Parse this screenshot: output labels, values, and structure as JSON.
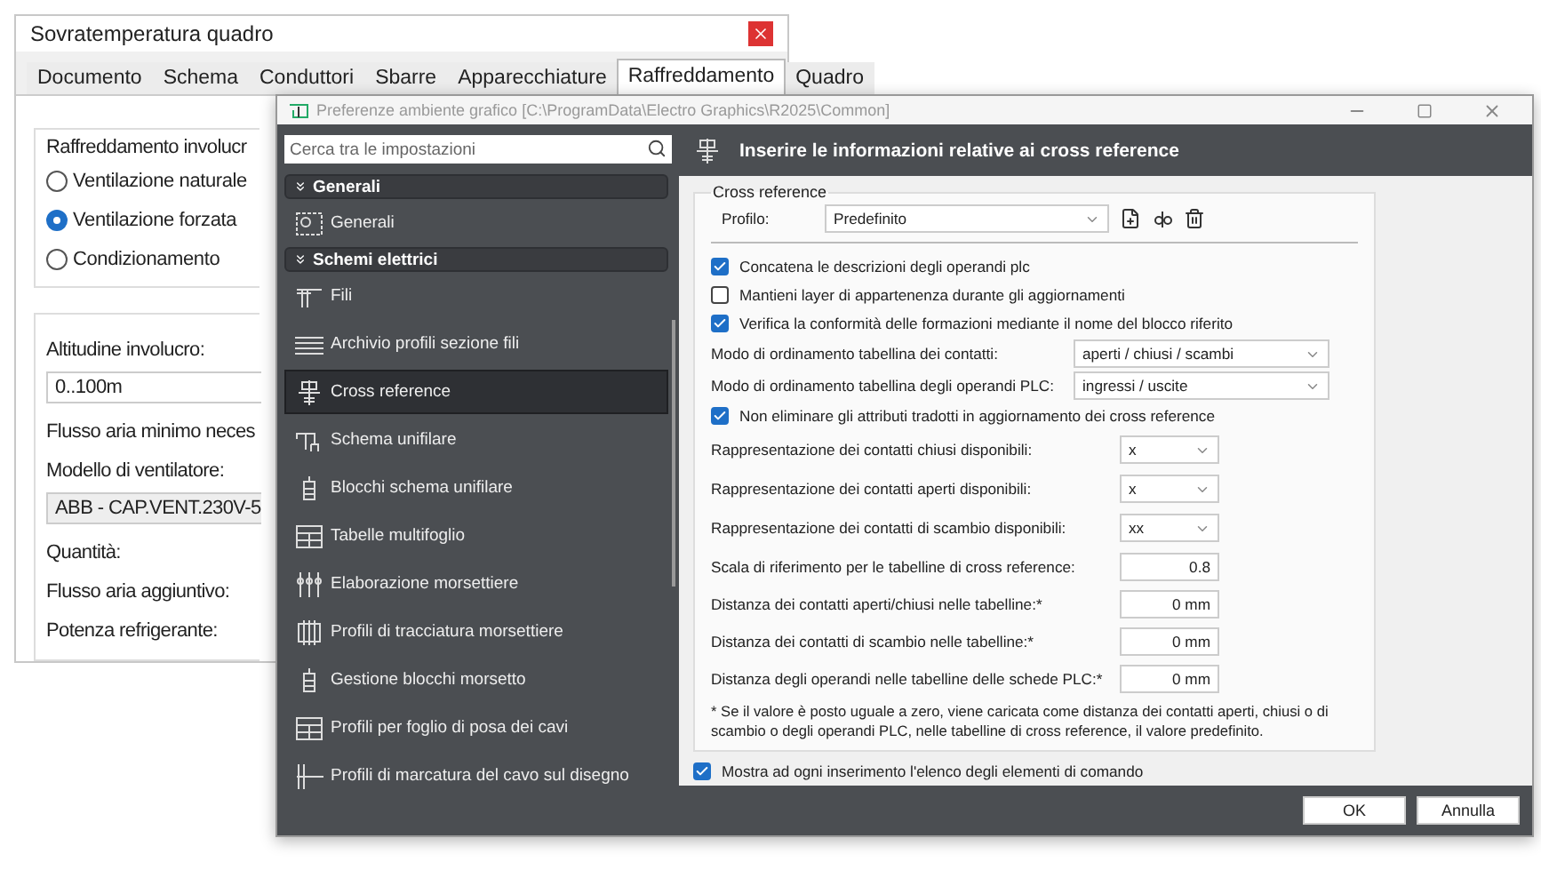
{
  "back_window": {
    "title": "Sovratemperatura quadro",
    "tabs": [
      {
        "label": "Documento",
        "selected": false
      },
      {
        "label": "Schema",
        "selected": false
      },
      {
        "label": "Conduttori",
        "selected": false
      },
      {
        "label": "Sbarre",
        "selected": false
      },
      {
        "label": "Apparecchiature",
        "selected": false
      },
      {
        "label": "Raffreddamento",
        "selected": true
      },
      {
        "label": "Quadro",
        "selected": false
      }
    ],
    "cooling_group": {
      "title": "Raffreddamento involucr",
      "options": [
        {
          "label": "Ventilazione naturale",
          "selected": false
        },
        {
          "label": "Ventilazione forzata",
          "selected": true
        },
        {
          "label": "Condizionamento",
          "selected": false
        }
      ]
    },
    "fields": [
      {
        "kind": "input",
        "label": "Altitudine involucro:",
        "value": "0..100m"
      },
      {
        "kind": "label",
        "label": "Flusso aria minimo neces"
      },
      {
        "kind": "select",
        "label": "Modello di ventilatore:",
        "value": "ABB - CAP.VENT.230V-5"
      },
      {
        "kind": "label",
        "label": "Quantità:"
      },
      {
        "kind": "label",
        "label": "Flusso aria aggiuntivo:"
      },
      {
        "kind": "label",
        "label": "Potenza refrigerante:"
      }
    ]
  },
  "window": {
    "title": "Preferenze ambiente grafico [C:\\ProgramData\\Electro Graphics\\R2025\\Common]"
  },
  "search": {
    "placeholder": "Cerca tra le impostazioni"
  },
  "sidebar": {
    "groups": [
      {
        "label": "Generali",
        "expanded": true,
        "items": [
          {
            "label": "Generali",
            "selected": false
          }
        ]
      },
      {
        "label": "Schemi elettrici",
        "expanded": true,
        "items": [
          {
            "label": "Fili",
            "selected": false
          },
          {
            "label": "Archivio profili sezione fili",
            "selected": false
          },
          {
            "label": "Cross reference",
            "selected": true
          },
          {
            "label": "Schema unifilare",
            "selected": false
          },
          {
            "label": "Blocchi schema unifilare",
            "selected": false
          },
          {
            "label": "Tabelle multifoglio",
            "selected": false
          },
          {
            "label": "Elaborazione morsettiere",
            "selected": false
          },
          {
            "label": "Profili di tracciatura morsettiere",
            "selected": false
          },
          {
            "label": "Gestione blocchi morsetto",
            "selected": false
          },
          {
            "label": "Profili per foglio di posa dei cavi",
            "selected": false
          },
          {
            "label": "Profili di marcatura del cavo sul disegno",
            "selected": false
          }
        ]
      }
    ]
  },
  "header": {
    "title": "Inserire le informazioni relative ai cross reference"
  },
  "group": {
    "title": "Cross reference",
    "profile_label": "Profilo:",
    "profile_value": "Predefinito"
  },
  "rows": [
    {
      "kind": "checkbox",
      "label": "Concatena le descrizioni degli operandi plc",
      "checked": true
    },
    {
      "kind": "checkbox",
      "label": "Mantieni layer di appartenenza durante gli aggiornamenti",
      "checked": false
    },
    {
      "kind": "checkbox",
      "label": "Verifica la conformità delle formazioni mediante il nome del blocco riferito",
      "checked": true
    },
    {
      "kind": "wideselect",
      "label": "Modo di ordinamento tabellina dei contatti:",
      "value": "aperti / chiusi / scambi"
    },
    {
      "kind": "wideselect",
      "label": "Modo di ordinamento tabellina degli operandi PLC:",
      "value": "ingressi / uscite"
    },
    {
      "kind": "checkbox",
      "label": "Non eliminare gli attributi tradotti in aggiornamento dei cross reference",
      "checked": true
    },
    {
      "kind": "select",
      "label": "Rappresentazione dei contatti chiusi disponibili:",
      "value": "x"
    },
    {
      "kind": "select",
      "label": "Rappresentazione dei contatti aperti disponibili:",
      "value": "x"
    },
    {
      "kind": "select",
      "label": "Rappresentazione dei contatti di scambio disponibili:",
      "value": "xx"
    },
    {
      "kind": "input",
      "label": "Scala di riferimento per le tabelline di cross reference:",
      "value": "0.8"
    },
    {
      "kind": "input",
      "label": "Distanza dei contatti aperti/chiusi nelle tabelline:*",
      "value": "0 mm"
    },
    {
      "kind": "input",
      "label": "Distanza dei contatti di scambio nelle tabelline:*",
      "value": "0 mm"
    },
    {
      "kind": "input",
      "label": "Distanza degli operandi nelle tabelline delle schede PLC:*",
      "value": "0 mm"
    }
  ],
  "note": "* Se il valore è posto uguale a zero, viene caricata come distanza dei contatti aperti, chiusi o di scambio o degli operandi PLC, nelle tabelline di cross reference, il valore predefinito.",
  "bottom_option": {
    "label": "Mostra ad ogni inserimento l'elenco degli elementi di comando",
    "checked": true
  },
  "buttons": [
    "OK",
    "Annulla"
  ]
}
